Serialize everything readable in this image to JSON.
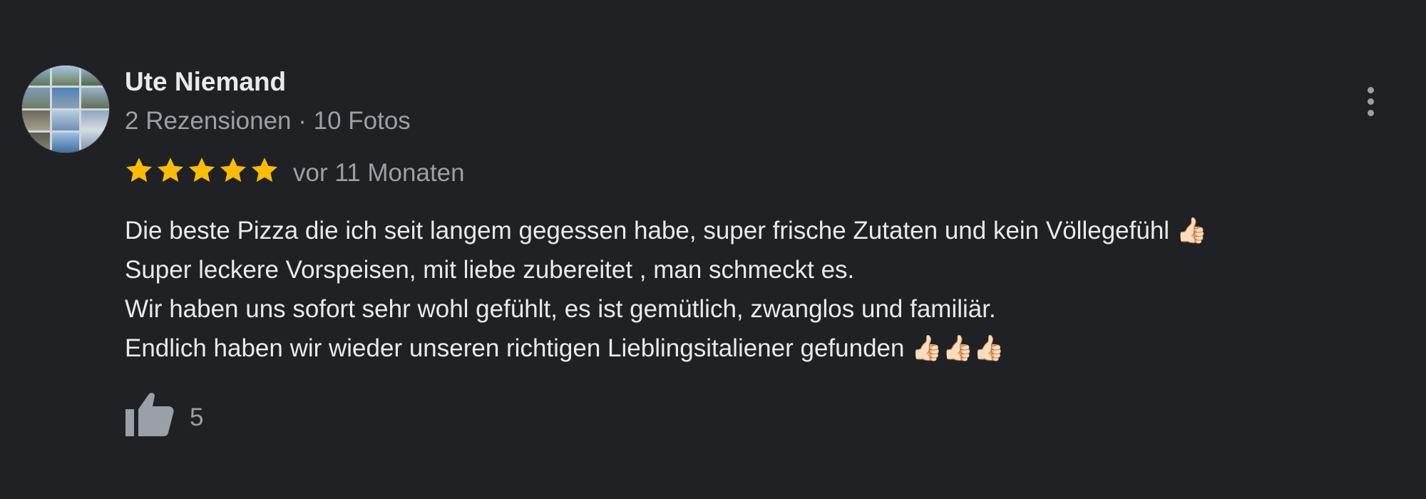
{
  "review": {
    "author": "Ute Niemand",
    "meta": "2 Rezensionen · 10 Fotos",
    "rating": 5,
    "max_rating": 5,
    "date": "vor 11 Monaten",
    "text_lines": [
      "Die beste Pizza die ich seit langem gegessen habe, super frische Zutaten und kein Völlegefühl 👍🏻",
      "Super leckere Vorspeisen, mit liebe zubereitet , man schmeckt es.",
      "Wir haben uns sofort sehr wohl gefühlt, es ist gemütlich, zwanglos und familiär.",
      "Endlich haben wir wieder unseren richtigen Lieblingsitaliener gefunden 👍🏻👍🏻👍🏻"
    ],
    "likes": "5"
  },
  "icons": {
    "star": "star-icon",
    "like": "thumbs-up-icon",
    "more": "more-vert-icon"
  },
  "colors": {
    "background": "#202124",
    "star": "#fbbc04",
    "primary_text": "#e8eaed",
    "secondary_text": "#9aa0a6"
  }
}
